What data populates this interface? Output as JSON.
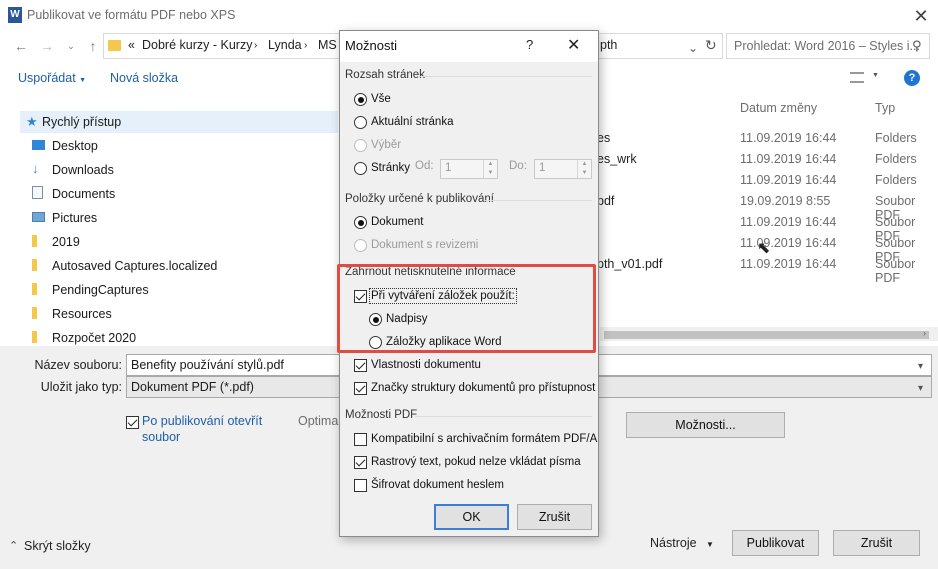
{
  "window": {
    "title": "Publikovat ve formátu PDF nebo XPS",
    "app_icon_letter": "W"
  },
  "address_bar": {
    "overflow": "«",
    "crumbs": [
      "Dobré kurzy - Kurzy",
      "Lynda",
      "MS"
    ],
    "visible_tail": "pth",
    "search_placeholder": "Prohledat: Word 2016 – Styles i..."
  },
  "toolbar": {
    "organize": "Uspořádat",
    "new_folder": "Nová složka"
  },
  "nav": {
    "items": [
      {
        "label": "Rychlý přístup",
        "icon": "star-icon"
      },
      {
        "label": "Desktop",
        "icon": "desktop-icon"
      },
      {
        "label": "Downloads",
        "icon": "download-icon"
      },
      {
        "label": "Documents",
        "icon": "document-icon"
      },
      {
        "label": "Pictures",
        "icon": "picture-icon"
      },
      {
        "label": "2019",
        "icon": "folder-icon"
      },
      {
        "label": "Autosaved Captures.localized",
        "icon": "folder-icon"
      },
      {
        "label": "PendingCaptures",
        "icon": "folder-icon"
      },
      {
        "label": "Resources",
        "icon": "folder-icon"
      },
      {
        "label": "Rozpočet 2020",
        "icon": "folder-icon"
      }
    ]
  },
  "file_list": {
    "headers": {
      "date": "Datum změny",
      "type": "Typ"
    },
    "rows": [
      {
        "name": "es",
        "date": "11.09.2019 16:44",
        "type": "Folders"
      },
      {
        "name": "es_wrk",
        "date": "11.09.2019 16:44",
        "type": "Folders"
      },
      {
        "name": "",
        "date": "11.09.2019 16:44",
        "type": "Folders"
      },
      {
        "name": "pdf",
        "date": "19.09.2019 8:55",
        "type": "Soubor PDF"
      },
      {
        "name": "",
        "date": "11.09.2019 16:44",
        "type": "Soubor PDF"
      },
      {
        "name": "",
        "date": "11.09.2019 16:44",
        "type": "Soubor PDF"
      },
      {
        "name": "pth_v01.pdf",
        "date": "11.09.2019 16:44",
        "type": "Soubor PDF"
      }
    ]
  },
  "save_form": {
    "filename_label": "Název souboru:",
    "filename_value": "Benefity používání stylů.pdf",
    "savetype_label": "Uložit jako typ:",
    "savetype_value": "Dokument PDF (*.pdf)",
    "open_after_line1": "Po publikování otevřít",
    "open_after_line2": "soubor",
    "optimize_partial": "Optima",
    "options_button": "Možnosti..."
  },
  "footer": {
    "hide_folders": "Skrýt složky",
    "tools": "Nástroje",
    "publish": "Publikovat",
    "cancel": "Zrušit"
  },
  "dialog": {
    "title": "Možnosti",
    "help": "?",
    "page_range": {
      "heading": "Rozsah stránek",
      "all": "Vše",
      "current": "Aktuální stránka",
      "selection": "Výběr",
      "pages": "Stránky",
      "from_label": "Od:",
      "from_value": "1",
      "to_label": "Do:",
      "to_value": "1"
    },
    "publish_what": {
      "heading": "Položky určené k publikování",
      "document": "Dokument",
      "with_markup": "Dokument s revizemi"
    },
    "non_printing": {
      "heading": "Zahrnout netisknutelné informace",
      "create_bookmarks": "Při vytváření záložek použít:",
      "headings": "Nadpisy",
      "word_bookmarks": "Záložky aplikace Word",
      "doc_properties": "Vlastnosti dokumentu",
      "structure_tags": "Značky struktury dokumentů pro přístupnost"
    },
    "pdf_options": {
      "heading": "Možnosti PDF",
      "iso": "Kompatibilní s archivačním formátem PDF/A",
      "bitmap": "Rastrový text, pokud nelze vkládat písma",
      "encrypt": "Šifrovat dokument heslem"
    },
    "ok": "OK",
    "cancel": "Zrušit"
  },
  "colors": {
    "link": "#1e5fa8",
    "highlight": "#e04c42",
    "nav_selected": "#e5f0fb",
    "dialog_bg": "#f0f0f0"
  }
}
